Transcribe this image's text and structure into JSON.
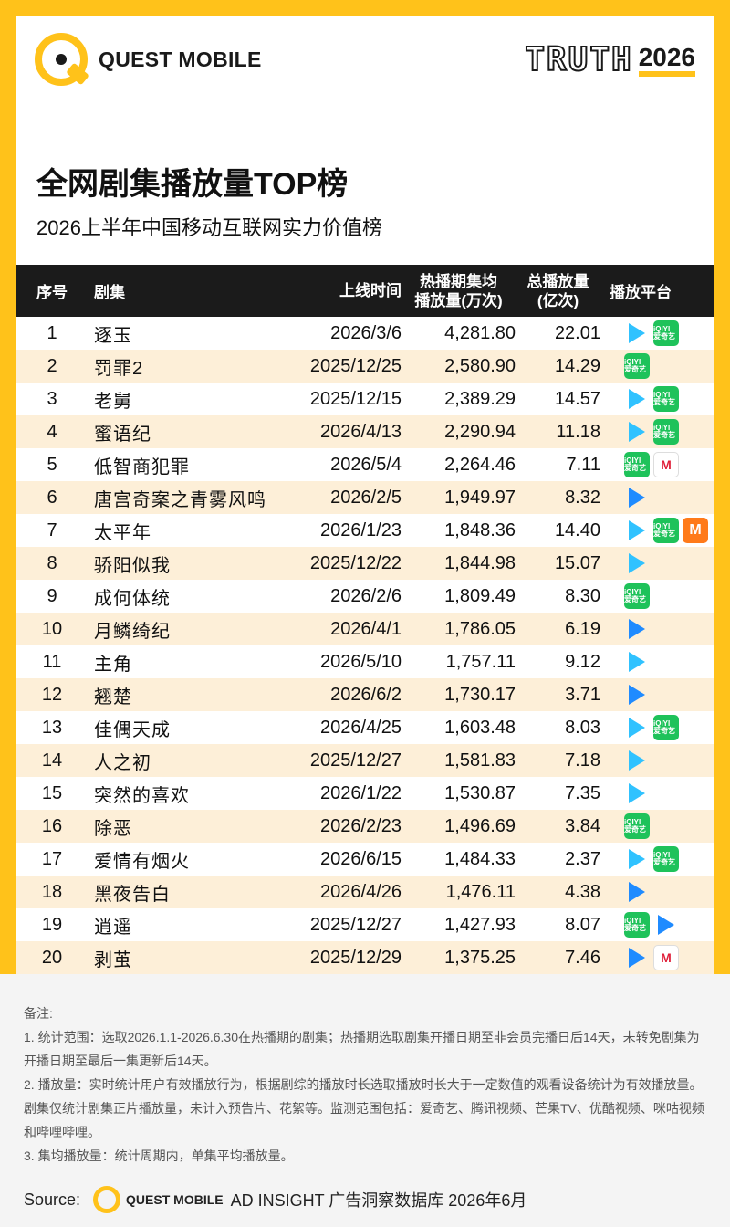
{
  "header": {
    "logo_text": "QUEST MOBILE",
    "truth_word": "TRUTH",
    "truth_year": "2026"
  },
  "title": "全网剧集播放量TOP榜",
  "subtitle": "2026上半年中国移动互联网实力价值榜",
  "table": {
    "columns": {
      "rank": "序号",
      "name": "剧集",
      "date": "上线时间",
      "avg_line1": "热播期集均",
      "avg_line2": "播放量(万次)",
      "total_line1": "总播放量",
      "total_line2": "(亿次)",
      "platform": "播放平台"
    },
    "rows": [
      {
        "rank": "1",
        "name": "逐玉",
        "date": "2026/3/6",
        "avg": "4,281.80",
        "total": "22.01",
        "platforms": [
          "tencent",
          "iqiyi"
        ]
      },
      {
        "rank": "2",
        "name": "罚罪2",
        "date": "2025/12/25",
        "avg": "2,580.90",
        "total": "14.29",
        "platforms": [
          "iqiyi"
        ]
      },
      {
        "rank": "3",
        "name": "老舅",
        "date": "2025/12/15",
        "avg": "2,389.29",
        "total": "14.57",
        "platforms": [
          "tencent",
          "iqiyi"
        ]
      },
      {
        "rank": "4",
        "name": "蜜语纪",
        "date": "2026/4/13",
        "avg": "2,290.94",
        "total": "11.18",
        "platforms": [
          "tencent",
          "iqiyi"
        ]
      },
      {
        "rank": "5",
        "name": "低智商犯罪",
        "date": "2026/5/4",
        "avg": "2,264.46",
        "total": "7.11",
        "platforms": [
          "iqiyi",
          "migu"
        ]
      },
      {
        "rank": "6",
        "name": "唐宫奇案之青雾风鸣",
        "date": "2026/2/5",
        "avg": "1,949.97",
        "total": "8.32",
        "platforms": [
          "youku"
        ]
      },
      {
        "rank": "7",
        "name": "太平年",
        "date": "2026/1/23",
        "avg": "1,848.36",
        "total": "14.40",
        "platforms": [
          "tencent",
          "iqiyi",
          "mango"
        ]
      },
      {
        "rank": "8",
        "name": "骄阳似我",
        "date": "2025/12/22",
        "avg": "1,844.98",
        "total": "15.07",
        "platforms": [
          "tencent"
        ]
      },
      {
        "rank": "9",
        "name": "成何体统",
        "date": "2026/2/6",
        "avg": "1,809.49",
        "total": "8.30",
        "platforms": [
          "iqiyi"
        ]
      },
      {
        "rank": "10",
        "name": "月鳞绮纪",
        "date": "2026/4/1",
        "avg": "1,786.05",
        "total": "6.19",
        "platforms": [
          "youku"
        ]
      },
      {
        "rank": "11",
        "name": "主角",
        "date": "2026/5/10",
        "avg": "1,757.11",
        "total": "9.12",
        "platforms": [
          "tencent"
        ]
      },
      {
        "rank": "12",
        "name": "翘楚",
        "date": "2026/6/2",
        "avg": "1,730.17",
        "total": "3.71",
        "platforms": [
          "youku"
        ]
      },
      {
        "rank": "13",
        "name": "佳偶天成",
        "date": "2026/4/25",
        "avg": "1,603.48",
        "total": "8.03",
        "platforms": [
          "tencent",
          "iqiyi"
        ]
      },
      {
        "rank": "14",
        "name": "人之初",
        "date": "2025/12/27",
        "avg": "1,581.83",
        "total": "7.18",
        "platforms": [
          "tencent"
        ]
      },
      {
        "rank": "15",
        "name": "突然的喜欢",
        "date": "2026/1/22",
        "avg": "1,530.87",
        "total": "7.35",
        "platforms": [
          "tencent"
        ]
      },
      {
        "rank": "16",
        "name": "除恶",
        "date": "2026/2/23",
        "avg": "1,496.69",
        "total": "3.84",
        "platforms": [
          "iqiyi"
        ]
      },
      {
        "rank": "17",
        "name": "爱情有烟火",
        "date": "2026/6/15",
        "avg": "1,484.33",
        "total": "2.37",
        "platforms": [
          "tencent",
          "iqiyi"
        ]
      },
      {
        "rank": "18",
        "name": "黑夜告白",
        "date": "2026/4/26",
        "avg": "1,476.11",
        "total": "4.38",
        "platforms": [
          "youku"
        ]
      },
      {
        "rank": "19",
        "name": "逍遥",
        "date": "2025/12/27",
        "avg": "1,427.93",
        "total": "8.07",
        "platforms": [
          "iqiyi",
          "youku"
        ]
      },
      {
        "rank": "20",
        "name": "剥茧",
        "date": "2025/12/29",
        "avg": "1,375.25",
        "total": "7.46",
        "platforms": [
          "youku",
          "migu"
        ]
      }
    ]
  },
  "platform_icons": {
    "tencent": {
      "label": "",
      "color": "#30c2ff"
    },
    "iqiyi": {
      "label": "iQIYI 爱奇艺",
      "color": "#1ec25a"
    },
    "youku": {
      "label": "",
      "color": "#1f8bff"
    },
    "mango": {
      "label": "M",
      "color": "#ff7a1a"
    },
    "migu": {
      "label": "M",
      "color": "#e0203a"
    }
  },
  "chart_data": {
    "type": "table",
    "title": "全网剧集播放量TOP榜",
    "subtitle": "2026上半年中国移动互联网实力价值榜",
    "columns": [
      "序号",
      "剧集",
      "上线时间",
      "热播期集均播放量(万次)",
      "总播放量(亿次)",
      "播放平台"
    ],
    "categories": [
      "逐玉",
      "罚罪2",
      "老舅",
      "蜜语纪",
      "低智商犯罪",
      "唐宫奇案之青雾风鸣",
      "太平年",
      "骄阳似我",
      "成何体统",
      "月鳞绮纪",
      "主角",
      "翘楚",
      "佳偶天成",
      "人之初",
      "突然的喜欢",
      "除恶",
      "爱情有烟火",
      "黑夜告白",
      "逍遥",
      "剥茧"
    ],
    "series": [
      {
        "name": "热播期集均播放量(万次)",
        "values": [
          4281.8,
          2580.9,
          2389.29,
          2290.94,
          2264.46,
          1949.97,
          1848.36,
          1844.98,
          1809.49,
          1786.05,
          1757.11,
          1730.17,
          1603.48,
          1581.83,
          1530.87,
          1496.69,
          1484.33,
          1476.11,
          1427.93,
          1375.25
        ]
      },
      {
        "name": "总播放量(亿次)",
        "values": [
          22.01,
          14.29,
          14.57,
          11.18,
          7.11,
          8.32,
          14.4,
          15.07,
          8.3,
          6.19,
          9.12,
          3.71,
          8.03,
          7.18,
          7.35,
          3.84,
          2.37,
          4.38,
          8.07,
          7.46
        ]
      }
    ]
  },
  "footer": {
    "notes_title": "备注:",
    "notes": [
      "1. 统计范围：选取2026.1.1-2026.6.30在热播期的剧集；热播期选取剧集开播日期至非会员完播日后14天，未转免剧集为开播日期至最后一集更新后14天。",
      "2. 播放量：实时统计用户有效播放行为，根据剧综的播放时长选取播放时长大于一定数值的观看设备统计为有效播放量。剧集仅统计剧集正片播放量，未计入预告片、花絮等。监测范围包括：爱奇艺、腾讯视频、芒果TV、优酷视频、咪咕视频和哔哩哔哩。",
      "3. 集均播放量：统计周期内，单集平均播放量。"
    ],
    "source_label": "Source:",
    "source_brand": "QUEST MOBILE",
    "source_text": "AD INSIGHT 广告洞察数据库 2026年6月"
  }
}
